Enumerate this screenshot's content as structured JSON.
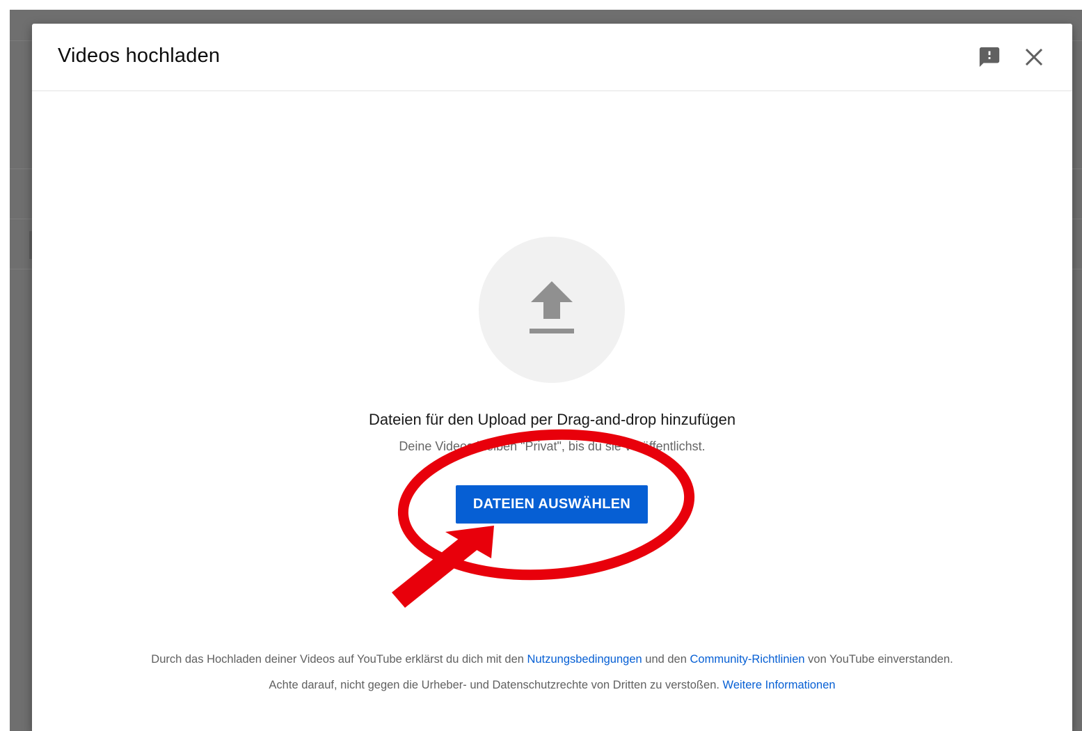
{
  "dialog": {
    "title": "Videos hochladen",
    "feedback_icon": "feedback-icon",
    "close_icon": "close-icon"
  },
  "upload": {
    "icon": "upload-arrow-icon",
    "drop_text": "Dateien für den Upload per Drag-and-drop hinzufügen",
    "privacy_text": "Deine Videos bleiben \"Privat\", bis du sie veröffentlichst.",
    "select_button": "DATEIEN AUSWÄHLEN"
  },
  "footer": {
    "line1_a": "Durch das Hochladen deiner Videos auf YouTube erklärst du dich mit den ",
    "terms_link": "Nutzungsbedingungen",
    "line1_b": " und den ",
    "guidelines_link": "Community-Richtlinien",
    "line1_c": " von YouTube einverstanden.",
    "line2_a": "Achte darauf, nicht gegen die Urheber- und Datenschutzrechte von Dritten zu verstoßen. ",
    "more_info_link": "Weitere Informationen"
  },
  "annotation": {
    "color": "#e8000b"
  },
  "colors": {
    "button": "#065fd4",
    "link": "#065fd4"
  }
}
